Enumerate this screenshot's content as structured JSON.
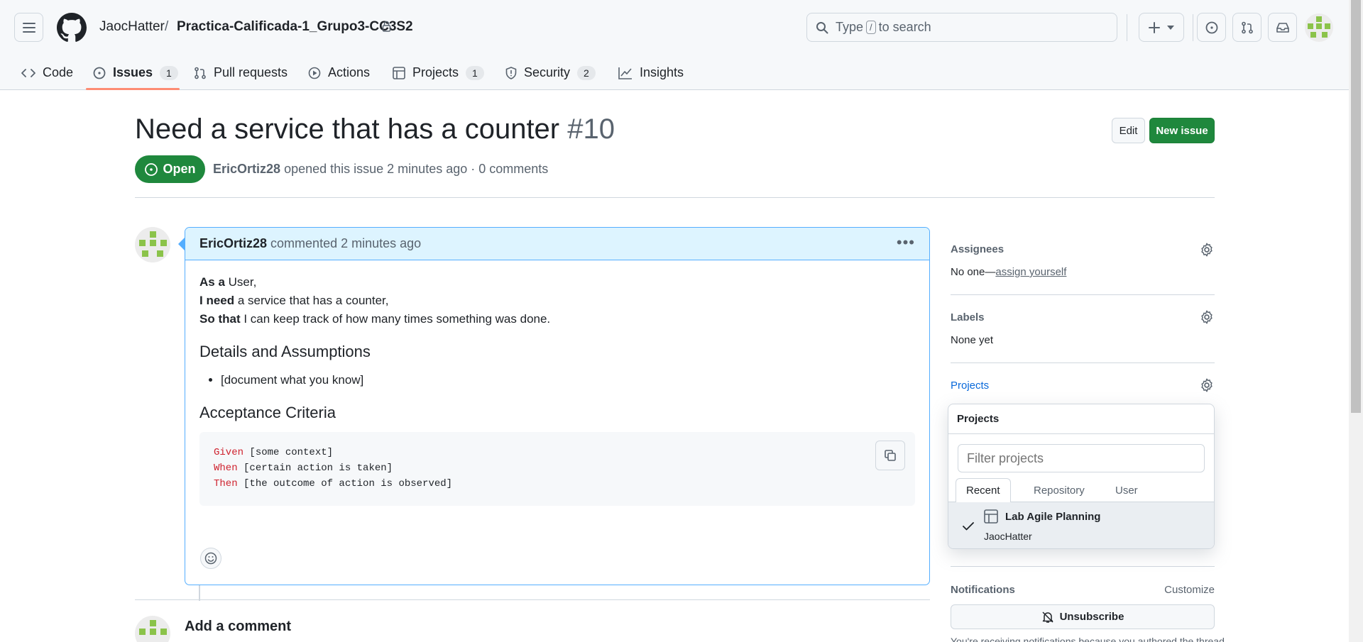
{
  "header": {
    "owner": "JaocHatter",
    "separator": "/",
    "repo": "Practica-Calificada-1_Grupo3-CC3S2",
    "search_prefix": "Type",
    "search_key": "/",
    "search_suffix": "to search"
  },
  "tabs": [
    {
      "label": "Code"
    },
    {
      "label": "Issues",
      "count": "1"
    },
    {
      "label": "Pull requests"
    },
    {
      "label": "Actions"
    },
    {
      "label": "Projects",
      "count": "1"
    },
    {
      "label": "Security",
      "count": "2"
    },
    {
      "label": "Insights"
    }
  ],
  "issue": {
    "title": "Need a service that has a counter",
    "number": "#10",
    "state": "Open",
    "author": "EricOrtiz28",
    "meta_rest": "opened this issue 2 minutes ago · 0 comments",
    "edit_label": "Edit",
    "new_issue_label": "New issue"
  },
  "comment": {
    "author": "EricOrtiz28",
    "action": "commented 2 minutes ago",
    "line1_bold": "As a",
    "line1_rest": " User,",
    "line2_bold": "I need",
    "line2_rest": " a service that has a counter,",
    "line3_bold": "So that",
    "line3_rest": " I can keep track of how many times something was done.",
    "heading1": "Details and Assumptions",
    "bullet1": "[document what you know]",
    "heading2": "Acceptance Criteria",
    "code": [
      {
        "kw": "Given",
        "text": " [some context]"
      },
      {
        "kw": "When",
        "text": " [certain action is taken]"
      },
      {
        "kw": "Then",
        "text": " [the outcome of action is observed]"
      }
    ]
  },
  "add_comment_label": "Add a comment",
  "sidebar": {
    "assignees_label": "Assignees",
    "assignees_value": "No one—",
    "assign_yourself": "assign yourself",
    "labels_label": "Labels",
    "labels_value": "None yet",
    "projects_label": "Projects",
    "notifications_label": "Notifications",
    "customize_label": "Customize",
    "unsubscribe_label": "Unsubscribe",
    "notif_text": "You're receiving notifications because you authored the thread."
  },
  "projects_dropdown": {
    "title": "Projects",
    "filter_placeholder": "Filter projects",
    "tabs": [
      "Recent",
      "Repository",
      "User"
    ],
    "item_name": "Lab Agile Planning",
    "item_owner": "JaocHatter"
  },
  "colors": {
    "accent_green": "#1f883d",
    "link_blue": "#0969da",
    "tab_underline": "#fd8c73",
    "comment_header_bg": "#ddf4ff"
  }
}
